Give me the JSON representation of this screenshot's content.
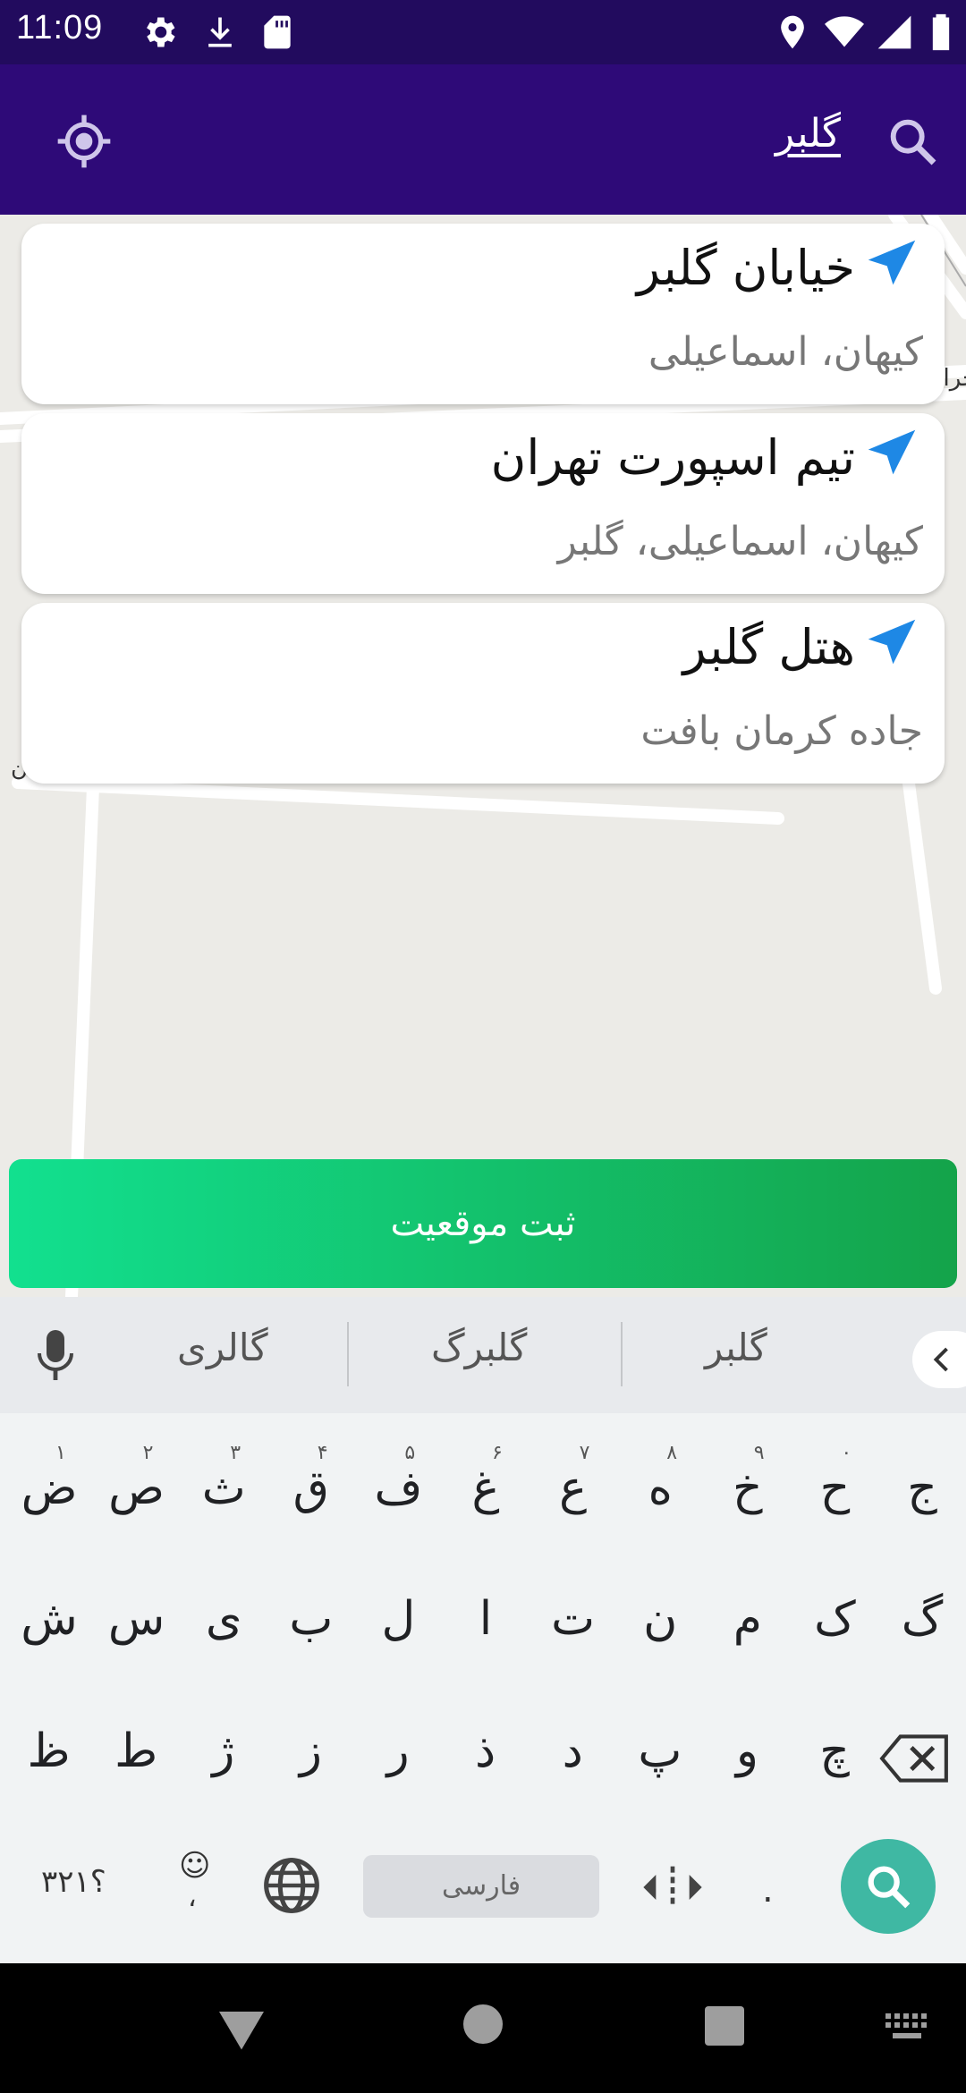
{
  "status_bar": {
    "time": "11:09"
  },
  "app_bar": {
    "query": "گلبر"
  },
  "map": {
    "labels": [
      "رحراب",
      "بن"
    ]
  },
  "results": [
    {
      "title": "خیابان گلبر",
      "subtitle": "کیهان، اسماعیلی"
    },
    {
      "title": "تیم اسپورت تهران",
      "subtitle": "کیهان، اسماعیلی، گلبر"
    },
    {
      "title": "هتل گلبر",
      "subtitle": "جاده کرمان بافت"
    }
  ],
  "submit_label": "ثبت موقعیت",
  "keyboard": {
    "suggestions": [
      "گلبر",
      "گلبرگ",
      "گالری"
    ],
    "row1": [
      "ج",
      "ح",
      "خ",
      "ه",
      "ع",
      "غ",
      "ف",
      "ق",
      "ث",
      "ص",
      "ض"
    ],
    "row1_hints": [
      "",
      "٠",
      "٩",
      "٨",
      "٧",
      "۶",
      "۵",
      "۴",
      "۳",
      "۲",
      "۱"
    ],
    "row2": [
      "گ",
      "ک",
      "م",
      "ن",
      "ت",
      "ا",
      "ل",
      "ب",
      "ی",
      "س",
      "ش"
    ],
    "row3": [
      "چ",
      "و",
      "پ",
      "د",
      "ذ",
      "ر",
      "ز",
      "ژ",
      "ط",
      "ظ"
    ],
    "numbers_key": "؟۳۲۱",
    "comma_key": "،",
    "period_key": ".",
    "space_label": "فارسی"
  },
  "colors": {
    "status_bar": "#220b5e",
    "app_bar": "#2e0a78",
    "submit_start": "#12e08f",
    "submit_end": "#14a34a",
    "nav_arrow": "#1e88e5",
    "search_key": "#3fb8a3"
  }
}
